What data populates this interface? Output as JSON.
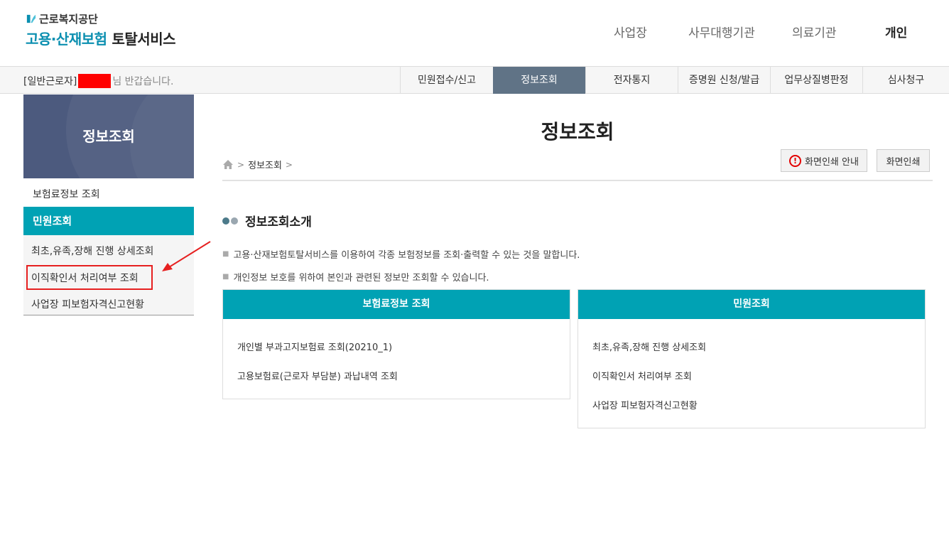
{
  "header": {
    "logo_top": "근로복지공단",
    "logo_main_1": "고용·산재보험",
    "logo_main_2": "토탈서비스",
    "nav": [
      "사업장",
      "사무대행기관",
      "의료기관",
      "개인"
    ]
  },
  "bar": {
    "user_type": "[일반근로자]",
    "greeting": "님 반갑습니다.",
    "tabs": [
      "민원접수/신고",
      "정보조회",
      "전자통지",
      "증명원 신청/발급",
      "업무상질병판정",
      "심사청구"
    ]
  },
  "sidebar": {
    "title": "정보조회",
    "item1": "보험료정보 조회",
    "category": "민원조회",
    "sub_items": [
      "최초,유족,장해 진행 상세조회",
      "이직확인서 처리여부 조회",
      "사업장 피보험자격신고현황"
    ]
  },
  "main": {
    "title": "정보조회",
    "breadcrumb": "정보조회",
    "print_guide_label": "화면인쇄 안내",
    "print_label": "화면인쇄",
    "section_title": "정보조회소개",
    "desc": [
      "고용·산재보험토탈서비스를 이용하여 각종 보험정보를 조회·출력할 수 있는 것을 말합니다.",
      "개인정보 보호를 위하여 본인과 관련된 정보만 조회할 수 있습니다."
    ],
    "cards": [
      {
        "title": "보험료정보 조회",
        "items": [
          "개인별 부과고지보험료 조회(20210_1)",
          "고용보험료(근로자 부담분) 과납내역 조회"
        ]
      },
      {
        "title": "민원조회",
        "items": [
          "최초,유족,장해 진행 상세조회",
          "이직확인서 처리여부 조회",
          "사업장 피보험자격신고현황"
        ]
      }
    ]
  },
  "colors": {
    "accent": "#00a2b4",
    "active_tab": "#607386",
    "sidebar_head": "#4c5a7e",
    "highlight": "#e62020"
  }
}
